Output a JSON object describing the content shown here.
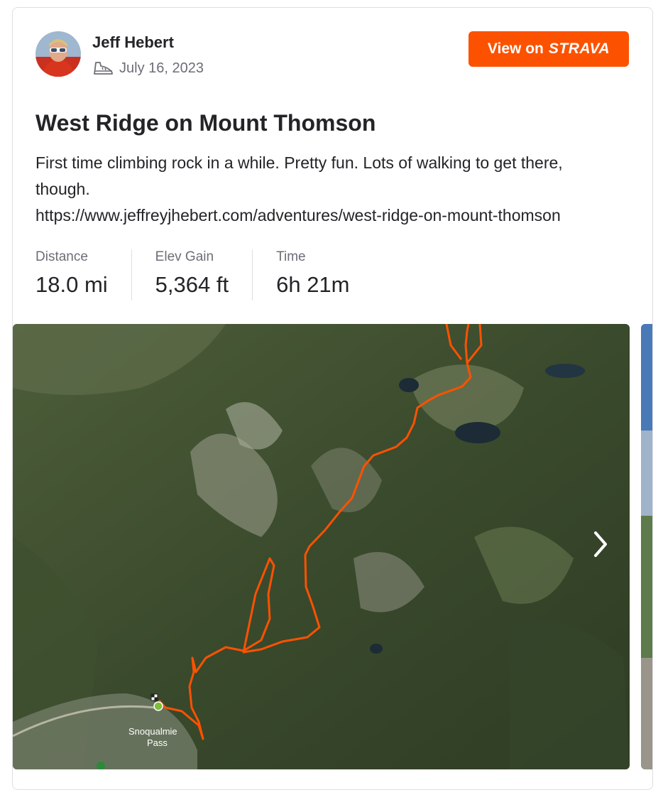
{
  "athlete": {
    "name": "Jeff Hebert",
    "activity_icon": "hike-shoe-icon",
    "date": "July 16, 2023"
  },
  "cta": {
    "prefix": "View on",
    "brand": "STRAVA",
    "color": "#fc5200"
  },
  "activity": {
    "title": "West Ridge on Mount Thomson",
    "description_lines": [
      "First time climbing rock in a while. Pretty fun. Lots of walking to get there, though.",
      "https://www.jeffreyjhebert.com/adventures/west-ridge-on-mount-thomson"
    ]
  },
  "stats": [
    {
      "label": "Distance",
      "value": "18.0 mi"
    },
    {
      "label": "Elev Gain",
      "value": "5,364 ft"
    },
    {
      "label": "Time",
      "value": "6h 21m"
    }
  ],
  "map": {
    "place_label_line1": "Snoqualmie",
    "place_label_line2": "Pass",
    "route_color": "#fc5200",
    "next_icon": "chevron-right-icon"
  }
}
